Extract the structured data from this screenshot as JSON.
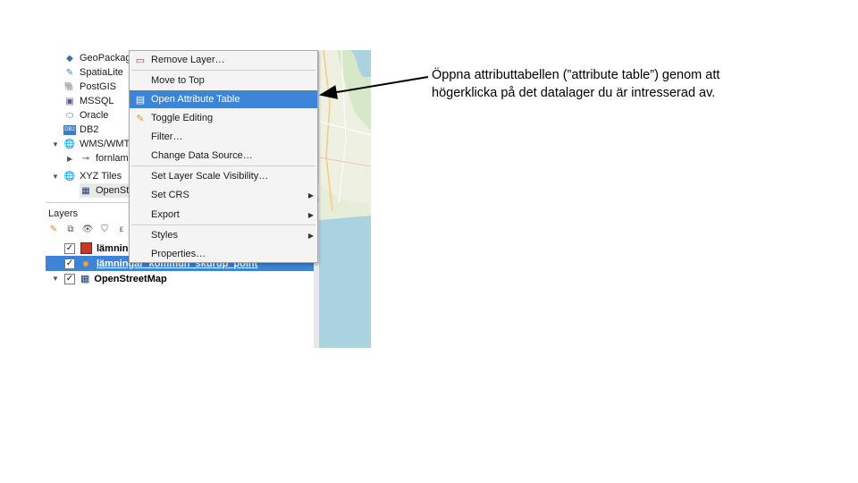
{
  "browser": {
    "items": [
      {
        "label": "GeoPackage",
        "icon": "geopackage-icon"
      },
      {
        "label": "SpatiaLite",
        "icon": "spatialite-icon"
      },
      {
        "label": "PostGIS",
        "icon": "postgis-icon"
      },
      {
        "label": "MSSQL",
        "icon": "mssql-icon"
      },
      {
        "label": "Oracle",
        "icon": "oracle-icon"
      },
      {
        "label": "DB2",
        "icon": "db2-icon"
      },
      {
        "label": "WMS/WMTS",
        "icon": "wms-icon"
      },
      {
        "label": "fornlamningar",
        "icon": "connection-icon"
      },
      {
        "label": "XYZ Tiles",
        "icon": "xyz-icon"
      },
      {
        "label": "OpenStreetMap",
        "icon": "tiles-icon"
      }
    ]
  },
  "layers": {
    "title": "Layers",
    "rows": [
      {
        "label": "lämningar",
        "checked": "✓",
        "swatch": "#c0392b"
      },
      {
        "label": "lämningar_kommun_skurup_point",
        "checked": "✓",
        "swatch": "#f0a030"
      },
      {
        "label": "OpenStreetMap",
        "checked": "✓"
      }
    ]
  },
  "context_menu": {
    "items": [
      {
        "label": "Remove Layer…"
      },
      {
        "label": "Move to Top"
      },
      {
        "label": "Open Attribute Table"
      },
      {
        "label": "Toggle Editing"
      },
      {
        "label": "Filter…"
      },
      {
        "label": "Change Data Source…"
      },
      {
        "label": "Set Layer Scale Visibility…"
      },
      {
        "label": "Set CRS"
      },
      {
        "label": "Export"
      },
      {
        "label": "Styles"
      },
      {
        "label": "Properties…"
      }
    ],
    "highlighted_item": "Open Attribute Table"
  },
  "annotation": {
    "line1": "Öppna attributtabellen (”attribute table”) genom att",
    "line2": "högerklicka på det datalager du är intresserad av."
  },
  "colors": {
    "menu_highlight": "#3b84d8",
    "layer_selected": "#3d83d6",
    "map_land": "#f1eee6",
    "map_water": "#aad3df"
  }
}
